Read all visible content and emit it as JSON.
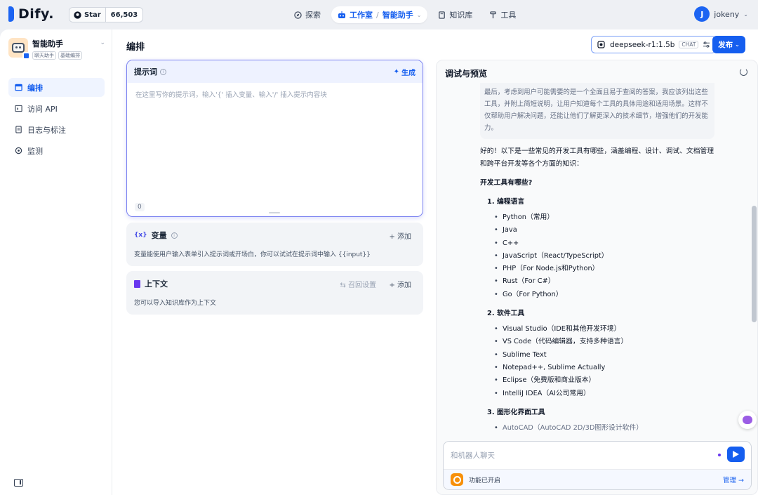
{
  "topbar": {
    "logo_text": "Dify.",
    "star_label": "Star",
    "star_count": "66,503",
    "nav": {
      "explore": "探索",
      "studio": "工作室",
      "studio_sep": "/",
      "current_app": "智能助手",
      "knowledge": "知识库",
      "tools": "工具"
    },
    "user": {
      "initial": "J",
      "name": "jokeny"
    }
  },
  "sidebar": {
    "app_name": "智能助手",
    "tags": [
      "聊天助手",
      "基础编排"
    ],
    "items": [
      {
        "label": "编排",
        "icon": "layout-icon"
      },
      {
        "label": "访问 API",
        "icon": "terminal-icon"
      },
      {
        "label": "日志与标注",
        "icon": "file-icon"
      },
      {
        "label": "监测",
        "icon": "monitor-icon"
      }
    ]
  },
  "header": {
    "title": "编排",
    "model_name": "deepseek-r1:1.5b",
    "model_badge": "CHAT",
    "publish_label": "发布"
  },
  "prompt": {
    "label": "提示词",
    "generate_label": "生成",
    "placeholder": "在这里写你的提示词，输入'{' 插入变量、输入'/' 插入提示内容块",
    "count": "0"
  },
  "variables": {
    "icon_text": "{x}",
    "title": "变量",
    "add_label": "+ 添加",
    "description": "变量能使用户输入表单引入提示词或开场白，你可以试试在提示词中输入 {{input}}"
  },
  "context": {
    "title": "上下文",
    "retrieval_label": "召回设置",
    "add_label": "+ 添加",
    "description": "您可以导入知识库作为上下文"
  },
  "debug": {
    "title": "调试与预览",
    "think_text": "最后，考虑到用户可能需要的是一个全面且易于查阅的答案，我应该列出这些工具，并附上简短说明，让用户知道每个工具的具体用途和适用场景。这样不仅帮助用户解决问题，还能让他们了解更深入的技术细节，增强他们的开发能力。",
    "intro": "好的！以下是一些常见的开发工具有哪些，涵盖编程、设计、调试、文档管理和跨平台开发等各个方面的知识：",
    "heading": "开发工具有哪些?",
    "sections": [
      {
        "title": "1. 编程语言",
        "items": [
          "Python（常用）",
          "Java",
          "C++",
          "JavaScript（React/TypeScript）",
          "PHP（For Node.js和Python）",
          "Rust（For C#）",
          "Go（For Python）"
        ]
      },
      {
        "title": "2. 软件工具",
        "items": [
          "Visual Studio（IDE和其他开发环境）",
          "VS Code（代码编辑器，支持多种语言）",
          "Sublime Text",
          "Notepad++, Sublime Actually",
          "Eclipse（免费版和商业版本）",
          "IntelliJ IDEA（AI公司常用）"
        ]
      },
      {
        "title": "3. 图形化界面工具",
        "items": [
          "AutoCAD（AutoCAD 2D/3D图形设计软件）"
        ]
      }
    ],
    "input_placeholder": "和机器人聊天",
    "feature_text": "功能已开启",
    "manage_label": "管理 →"
  }
}
